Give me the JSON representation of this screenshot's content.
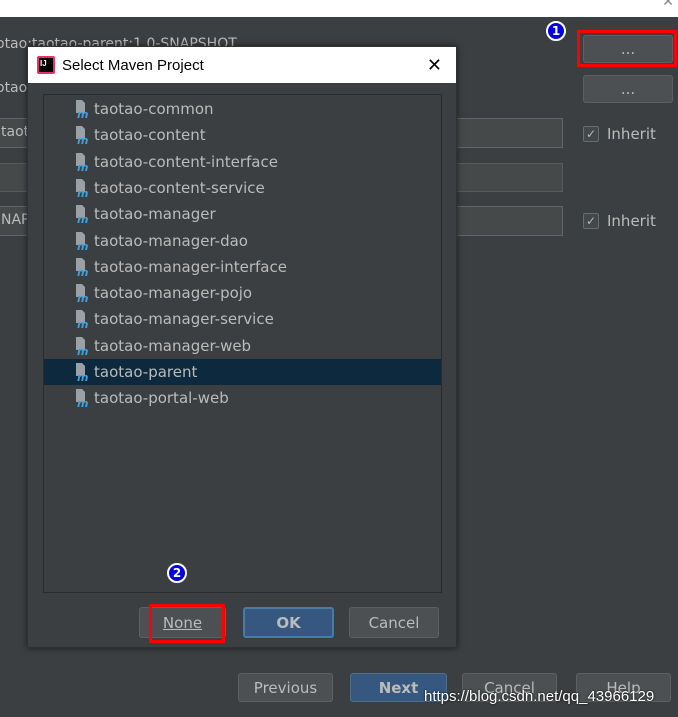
{
  "background": {
    "parent_text": "otao:taotao-parent:1.0-SNAPSHOT",
    "row2_text": "otao",
    "field1_value": "taot",
    "field3_value": "NAP",
    "browse_button_1": "...",
    "browse_button_2": "...",
    "inherit_1": "Inherit",
    "inherit_2": "Inherit",
    "inherit_1_checked": true,
    "inherit_2_checked": true,
    "buttons": {
      "previous": "Previous",
      "next": "Next",
      "cancel": "Cancel",
      "help": "Help"
    }
  },
  "dialog": {
    "title": "Select Maven Project",
    "close_icon": "close-icon",
    "items": [
      {
        "label": "taotao-common"
      },
      {
        "label": "taotao-content"
      },
      {
        "label": "taotao-content-interface"
      },
      {
        "label": "taotao-content-service"
      },
      {
        "label": "taotao-manager"
      },
      {
        "label": "taotao-manager-dao"
      },
      {
        "label": "taotao-manager-interface"
      },
      {
        "label": "taotao-manager-pojo"
      },
      {
        "label": "taotao-manager-service"
      },
      {
        "label": "taotao-manager-web"
      },
      {
        "label": "taotao-parent",
        "selected": true
      },
      {
        "label": "taotao-portal-web"
      }
    ],
    "buttons": {
      "none": "None",
      "ok": "OK",
      "cancel": "Cancel"
    }
  },
  "annotations": {
    "badge_1": "1",
    "badge_2": "2",
    "highlight_color": "#ff0000",
    "badge_color": "#0000e0"
  },
  "watermark": "https://blog.csdn.net/qq_43966129",
  "colors": {
    "background": "#3c3f41",
    "selection": "#0d293e",
    "primary_button": "#365880"
  }
}
